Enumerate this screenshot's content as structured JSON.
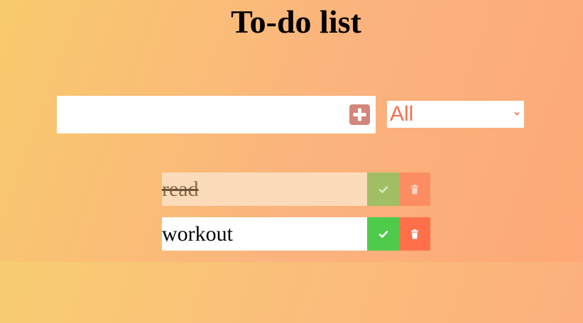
{
  "header": {
    "title": "To-do list"
  },
  "add_form": {
    "input_value": "",
    "input_placeholder": "",
    "add_icon": "plus-square-icon",
    "accent_color": "#d2877a"
  },
  "filter": {
    "selected": "All",
    "text_color": "#f3704e"
  },
  "todos": [
    {
      "text": "read",
      "completed": true
    },
    {
      "text": "workout",
      "completed": false
    }
  ],
  "colors": {
    "check_active": "#4ecb4a",
    "check_completed": "#a2be65",
    "trash_active": "#ff704a",
    "trash_completed": "#fc8d63"
  }
}
